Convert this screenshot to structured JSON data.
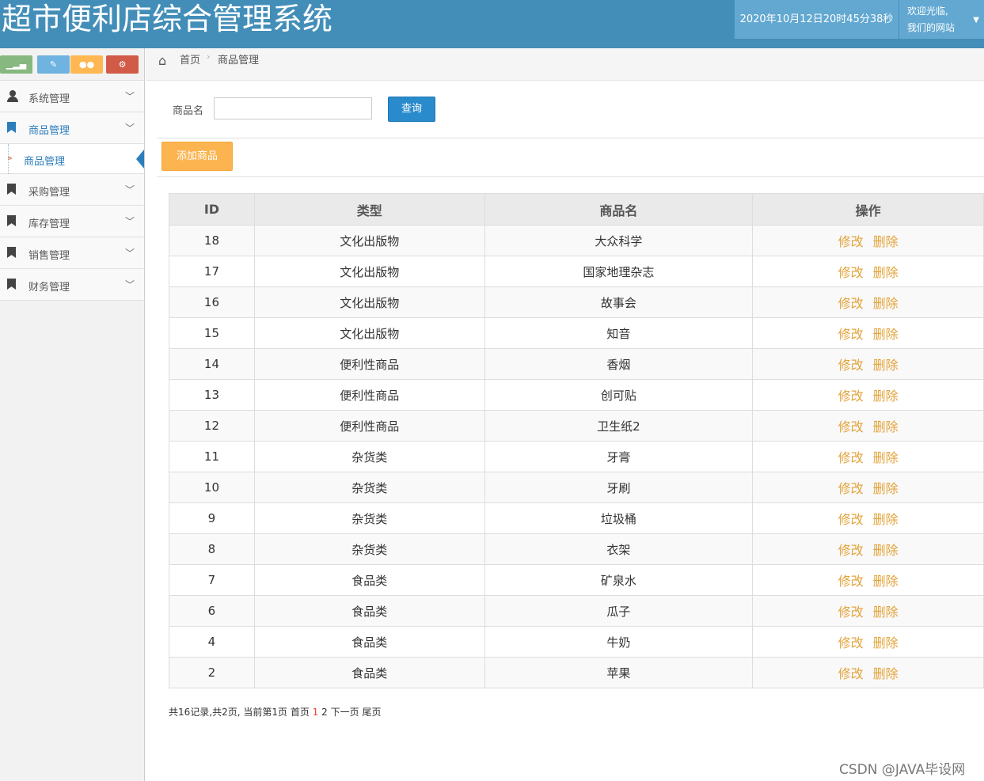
{
  "header": {
    "title": "超市便利店综合管理系统",
    "datetime": "2020年10月12日20时45分38秒",
    "welcome_line1": "欢迎光临,",
    "welcome_line2": "我们的网站"
  },
  "sidebar": {
    "shortcut_icons": [
      "signal-icon",
      "pencil-icon",
      "users-icon",
      "cogs-icon"
    ],
    "items": [
      {
        "label": "系统管理",
        "icon": "user-icon"
      },
      {
        "label": "商品管理",
        "icon": "bookmark-icon",
        "active": true
      },
      {
        "label": "采购管理",
        "icon": "bookmark-icon"
      },
      {
        "label": "库存管理",
        "icon": "bookmark-icon"
      },
      {
        "label": "销售管理",
        "icon": "bookmark-icon"
      },
      {
        "label": "财务管理",
        "icon": "bookmark-icon"
      }
    ],
    "sub_item": "商品管理"
  },
  "breadcrumb": {
    "home": "首页",
    "current": "商品管理"
  },
  "search": {
    "label": "商品名",
    "value": "",
    "button": "查询"
  },
  "add_button": "添加商品",
  "table": {
    "headers": [
      "ID",
      "类型",
      "商品名",
      "操作"
    ],
    "edit_label": "修改",
    "delete_label": "删除",
    "rows": [
      {
        "id": "18",
        "type": "文化出版物",
        "name": "大众科学"
      },
      {
        "id": "17",
        "type": "文化出版物",
        "name": "国家地理杂志"
      },
      {
        "id": "16",
        "type": "文化出版物",
        "name": "故事会"
      },
      {
        "id": "15",
        "type": "文化出版物",
        "name": "知音"
      },
      {
        "id": "14",
        "type": "便利性商品",
        "name": "香烟"
      },
      {
        "id": "13",
        "type": "便利性商品",
        "name": "创可贴"
      },
      {
        "id": "12",
        "type": "便利性商品",
        "name": "卫生纸2"
      },
      {
        "id": "11",
        "type": "杂货类",
        "name": "牙膏"
      },
      {
        "id": "10",
        "type": "杂货类",
        "name": "牙刷"
      },
      {
        "id": "9",
        "type": "杂货类",
        "name": "垃圾桶"
      },
      {
        "id": "8",
        "type": "杂货类",
        "name": "衣架"
      },
      {
        "id": "7",
        "type": "食品类",
        "name": "矿泉水"
      },
      {
        "id": "6",
        "type": "食品类",
        "name": "瓜子"
      },
      {
        "id": "4",
        "type": "食品类",
        "name": "牛奶"
      },
      {
        "id": "2",
        "type": "食品类",
        "name": "苹果"
      }
    ]
  },
  "pager": {
    "summary": "共16记录,共2页, 当前第1页",
    "first": "首页",
    "page1": "1",
    "page2": "2",
    "next": "下一页",
    "last": "尾页"
  },
  "watermark": "CSDN @JAVA毕设网",
  "colors": {
    "header_bg": "#438eb9",
    "accent": "#2b7dbc",
    "add_button": "#fbb450",
    "link": "#e3a33a"
  }
}
